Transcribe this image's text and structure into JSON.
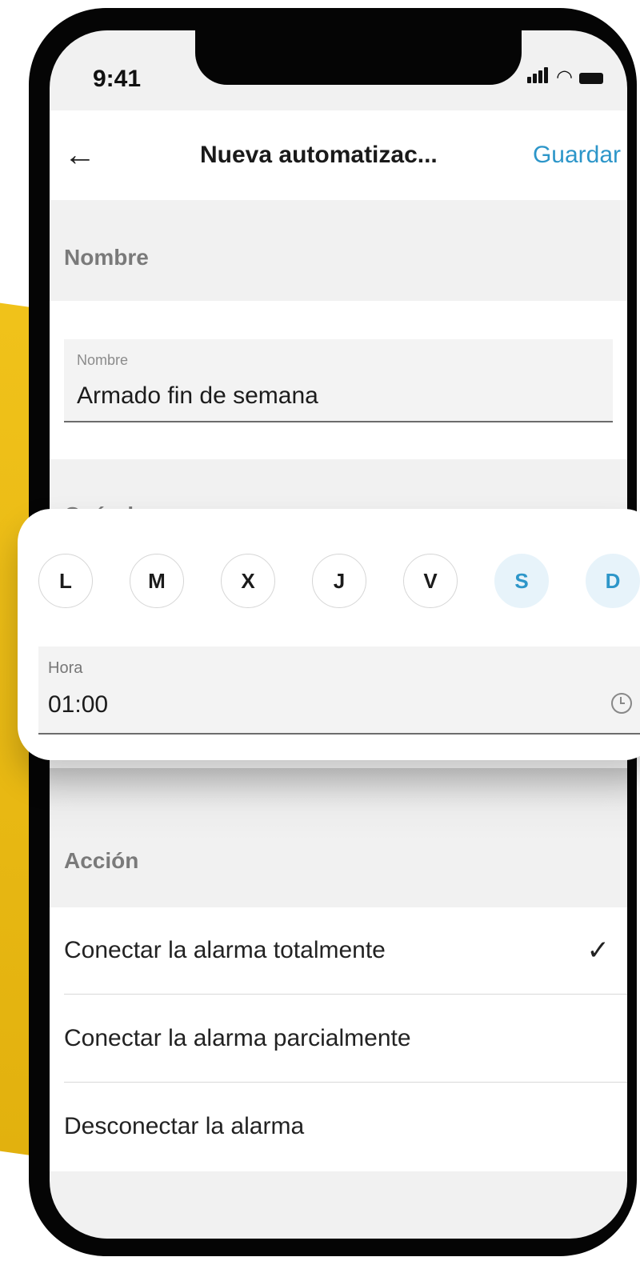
{
  "status_bar": {
    "time": "9:41"
  },
  "navbar": {
    "back_icon": "arrow-left",
    "title": "Nueva automatizac...",
    "save_label": "Guardar"
  },
  "sections": {
    "name_header": "Nombre",
    "when_header": "Cuándo",
    "action_header": "Acción"
  },
  "name_field": {
    "label": "Nombre",
    "value": "Armado fin de semana"
  },
  "days": [
    {
      "label": "L",
      "selected": false
    },
    {
      "label": "M",
      "selected": false
    },
    {
      "label": "X",
      "selected": false
    },
    {
      "label": "J",
      "selected": false
    },
    {
      "label": "V",
      "selected": false
    },
    {
      "label": "S",
      "selected": true
    },
    {
      "label": "D",
      "selected": true
    }
  ],
  "hora_field": {
    "label": "Hora",
    "value": "01:00",
    "icon": "clock-icon"
  },
  "actions": [
    {
      "label": "Conectar la alarma totalmente",
      "checked": true
    },
    {
      "label": "Conectar la alarma parcialmente",
      "checked": false
    },
    {
      "label": "Desconectar la alarma",
      "checked": false
    }
  ],
  "colors": {
    "accent": "#2d96c9",
    "selected_day_bg": "#e7f3fa",
    "background_yellow": "#e8b812"
  }
}
